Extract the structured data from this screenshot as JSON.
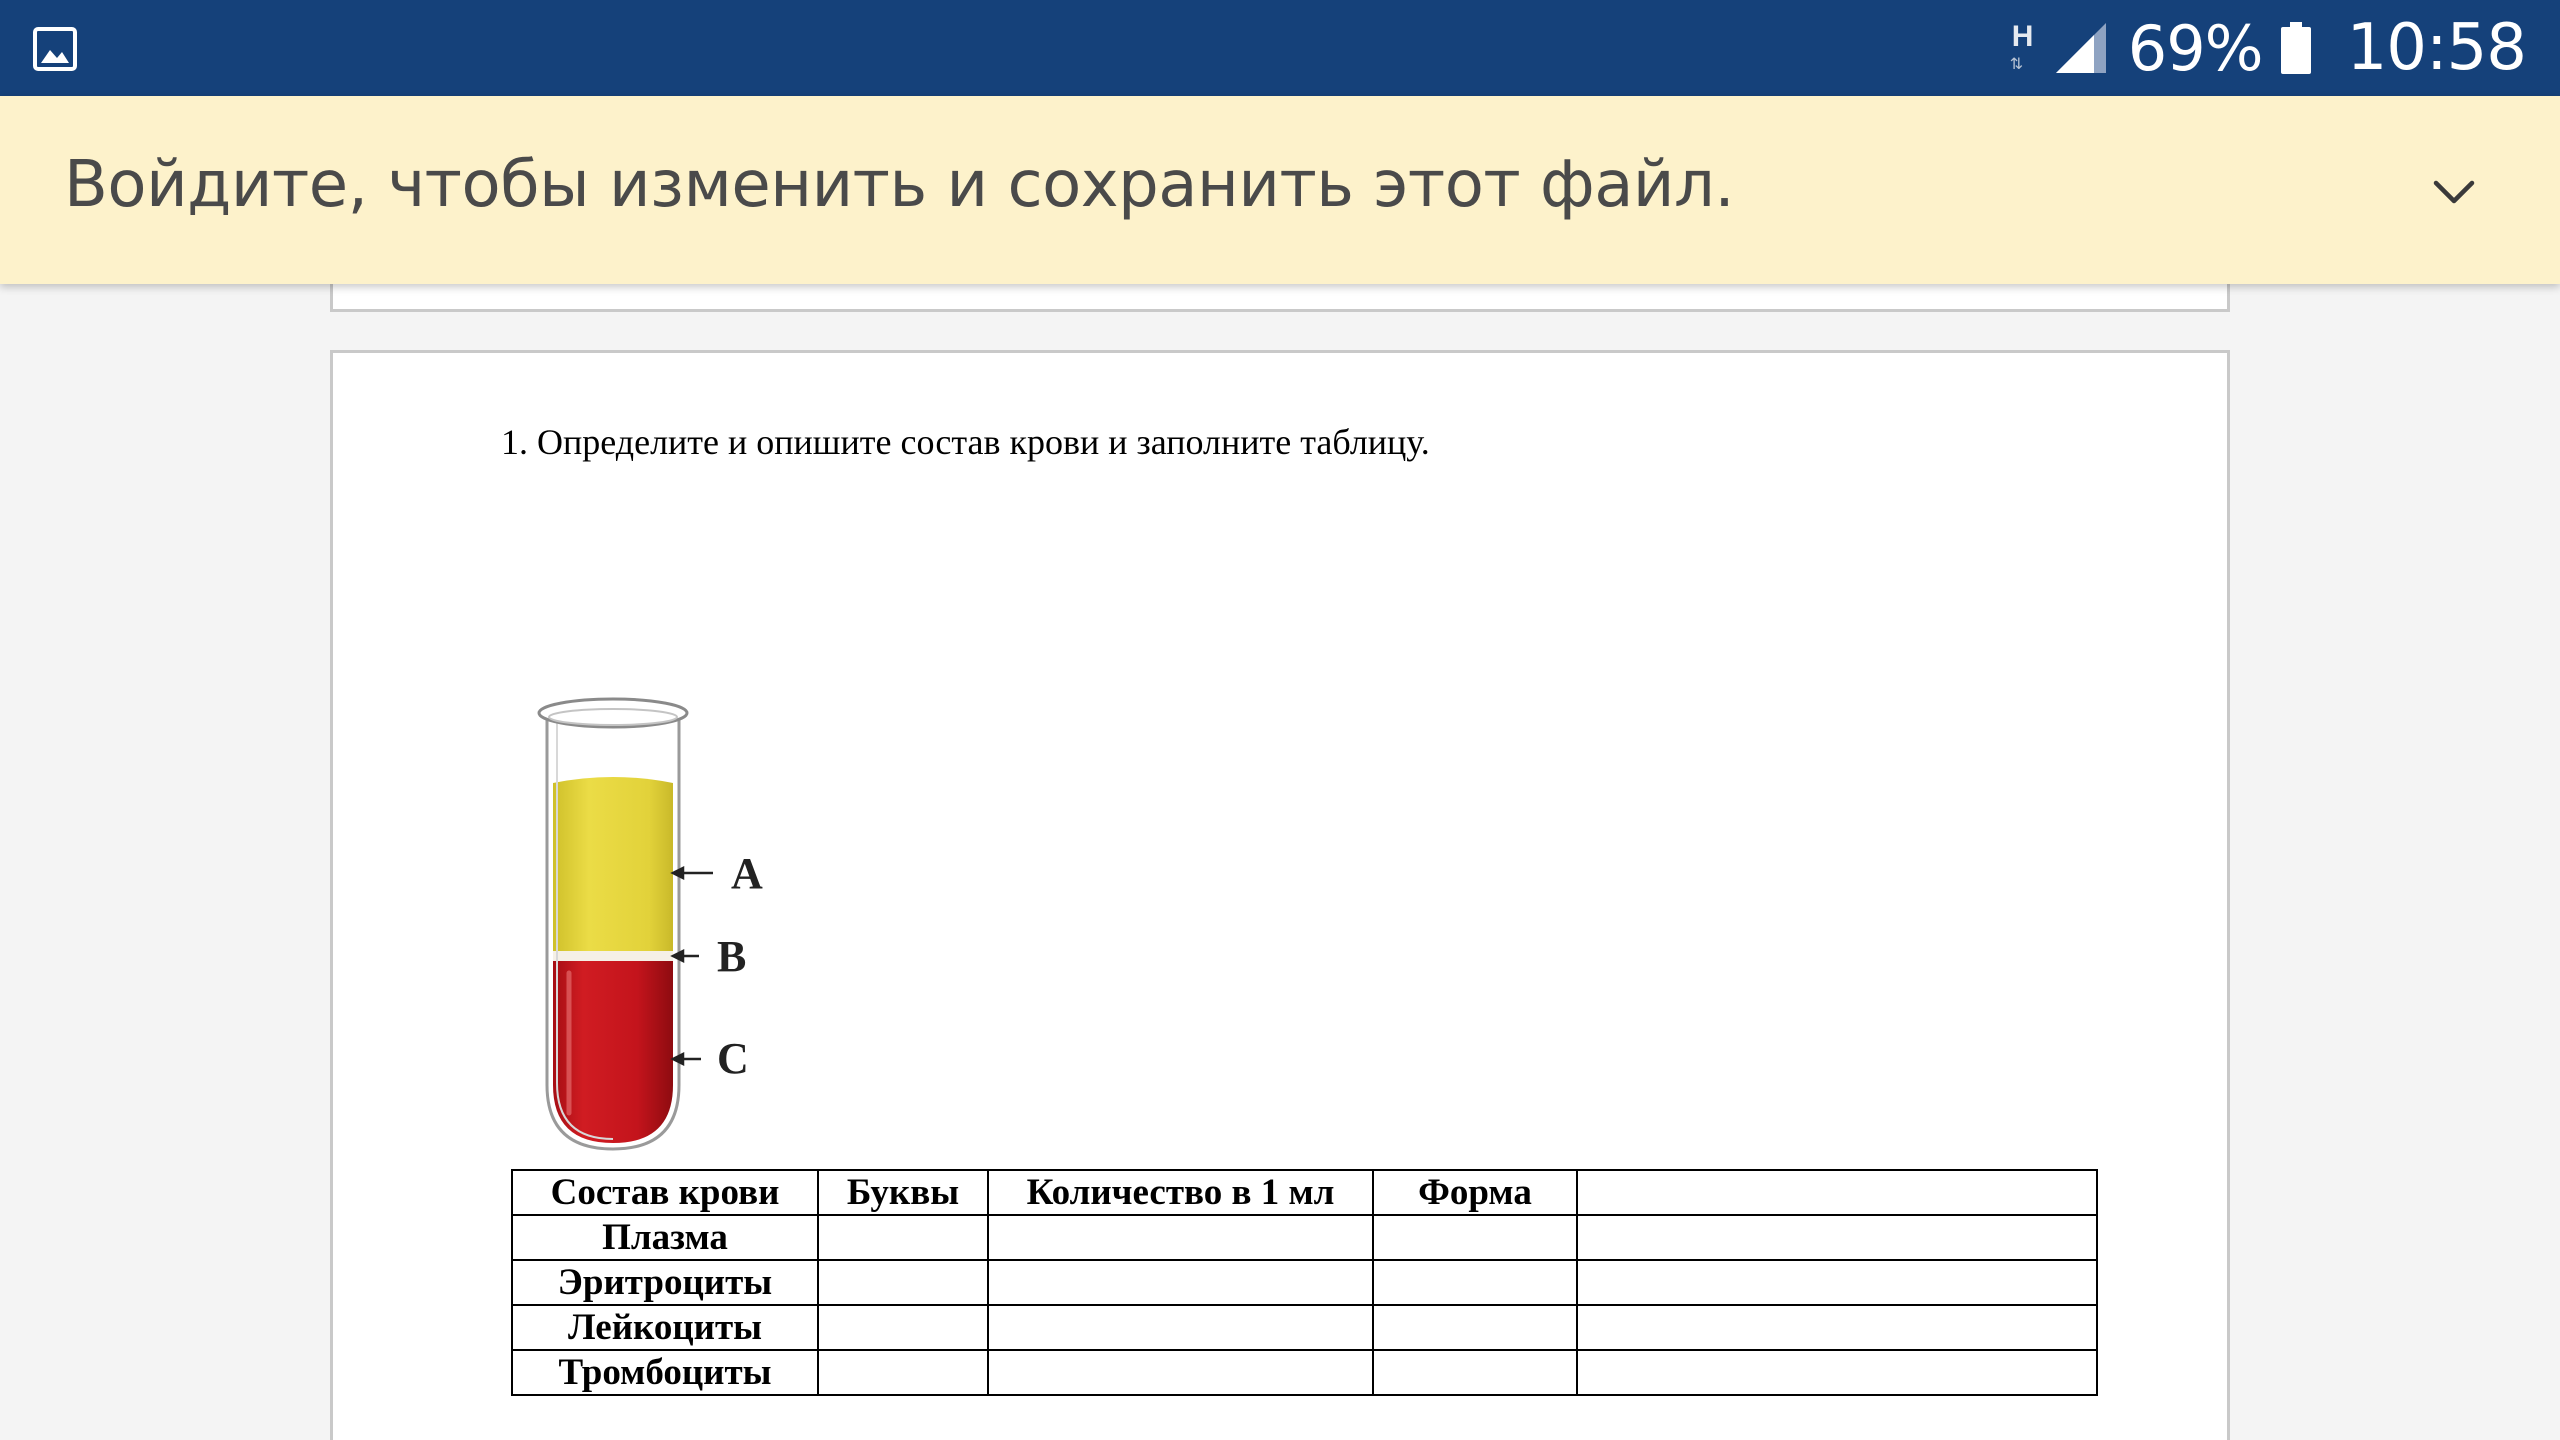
{
  "status_bar": {
    "network_type": "H",
    "battery_percent": "69%",
    "time": "10:58",
    "left_icon": "gallery-icon"
  },
  "notice": {
    "text": "Войдите, чтобы изменить и сохранить этот файл.",
    "expand_icon": "chevron-down-icon"
  },
  "document": {
    "question": "1. Определите и опишите состав крови и заполните таблицу.",
    "figure": {
      "labels": [
        "A",
        "B",
        "C"
      ],
      "colors": {
        "plasma": "#e4d43a",
        "red_cells": "#c4141c",
        "tube_outline": "#9a9a9a"
      }
    },
    "table": {
      "headers": [
        "Состав крови",
        "Буквы",
        "Количество в 1 мл",
        "Форма",
        ""
      ],
      "rows": [
        [
          "Плазма",
          "",
          "",
          "",
          ""
        ],
        [
          "Эритроциты",
          "",
          "",
          "",
          ""
        ],
        [
          "Лейкоциты",
          "",
          "",
          "",
          ""
        ],
        [
          "Тромбоциты",
          "",
          "",
          "",
          ""
        ]
      ]
    }
  },
  "colors": {
    "status_bar_bg": "#15417a",
    "notice_bg": "#fdf2cb",
    "page_bg": "#f4f4f4"
  }
}
